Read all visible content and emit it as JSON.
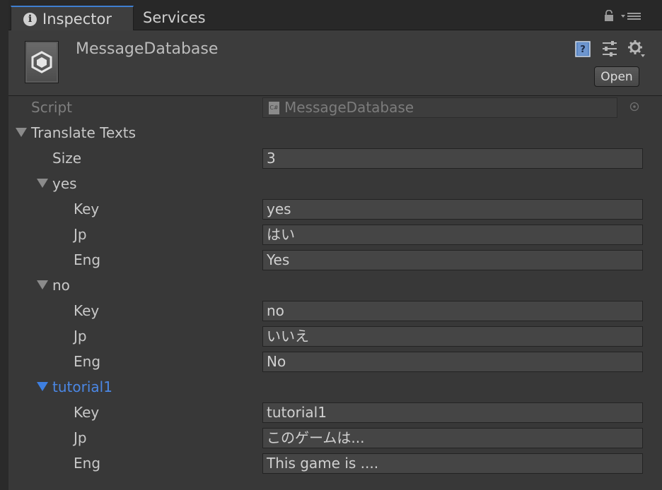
{
  "tabs": {
    "inspector": "Inspector",
    "services": "Services"
  },
  "header": {
    "title": "MessageDatabase",
    "open_button": "Open"
  },
  "script_row": {
    "label": "Script",
    "value": "MessageDatabase",
    "icon_text": "C#"
  },
  "translate_texts": {
    "label": "Translate Texts",
    "size_label": "Size",
    "size_value": "3",
    "elements": [
      {
        "name": "yes",
        "key_label": "Key",
        "key": "yes",
        "jp_label": "Jp",
        "jp": "はい",
        "eng_label": "Eng",
        "eng": "Yes"
      },
      {
        "name": "no",
        "key_label": "Key",
        "key": "no",
        "jp_label": "Jp",
        "jp": "いいえ",
        "eng_label": "Eng",
        "eng": "No"
      },
      {
        "name": "tutorial1",
        "key_label": "Key",
        "key": "tutorial1",
        "jp_label": "Jp",
        "jp": "このゲームは...",
        "eng_label": "Eng",
        "eng": "This game is ...."
      }
    ]
  },
  "colors": {
    "selected": "#4b87e4",
    "tab_accent": "#3f7fd1",
    "background": "#383838"
  },
  "icons": [
    "info-icon",
    "lock-icon",
    "menu-icon",
    "unity-script-icon",
    "help-book-icon",
    "sliders-icon",
    "gear-icon",
    "csharp-file-icon",
    "object-picker-icon",
    "foldout-triangle-icon"
  ]
}
